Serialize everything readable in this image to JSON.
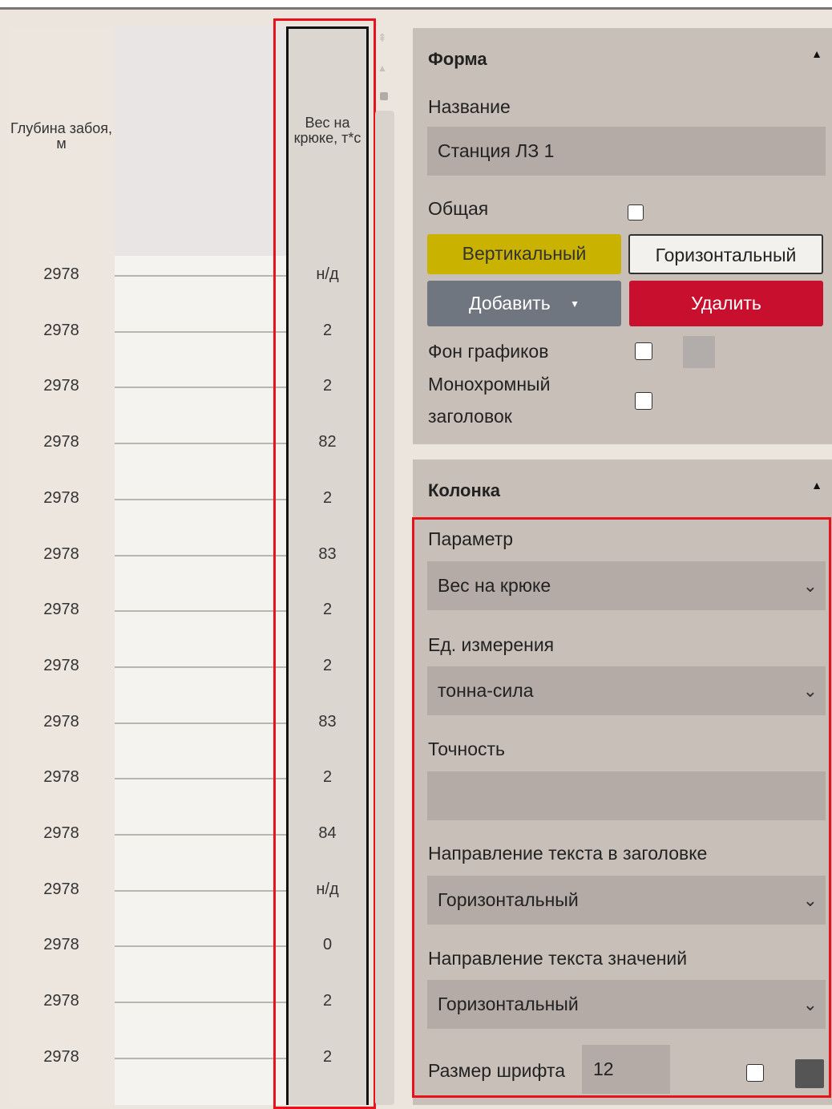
{
  "track": {
    "depth_header": "Глубина забоя, м",
    "value_header": "Вес на крюке, т*с",
    "rows": [
      {
        "depth": "2978",
        "value": "н/д"
      },
      {
        "depth": "2978",
        "value": "2"
      },
      {
        "depth": "2978",
        "value": "2"
      },
      {
        "depth": "2978",
        "value": "82"
      },
      {
        "depth": "2978",
        "value": "2"
      },
      {
        "depth": "2978",
        "value": "83"
      },
      {
        "depth": "2978",
        "value": "2"
      },
      {
        "depth": "2978",
        "value": "2"
      },
      {
        "depth": "2978",
        "value": "83"
      },
      {
        "depth": "2978",
        "value": "2"
      },
      {
        "depth": "2978",
        "value": "84"
      },
      {
        "depth": "2978",
        "value": "н/д"
      },
      {
        "depth": "2978",
        "value": "0"
      },
      {
        "depth": "2978",
        "value": "2"
      },
      {
        "depth": "2978",
        "value": "2"
      }
    ]
  },
  "form": {
    "title": "Форма",
    "name_label": "Название",
    "name_value": "Станция ЛЗ 1",
    "shared_label": "Общая",
    "vertical_button": "Вертикальный",
    "horizontal_button": "Горизонтальный",
    "add_button": "Добавить",
    "delete_button": "Удалить",
    "chart_bg_label": "Фон графиков",
    "mono_label_1": "Монохромный",
    "mono_label_2": "заголовок"
  },
  "column": {
    "title": "Колонка",
    "param_label": "Параметр",
    "param_value": "Вес на крюке",
    "unit_label": "Ед. измерения",
    "unit_value": "тонна-сила",
    "precision_label": "Точность",
    "precision_value": "",
    "header_dir_label": "Направление текста в заголовке",
    "header_dir_value": "Горизонтальный",
    "values_dir_label": "Направление текста значений",
    "values_dir_value": "Горизонтальный",
    "font_size_label": "Размер шрифта",
    "font_size_value": "12"
  },
  "colors": {
    "accent_yellow": "#c9b200",
    "danger_red": "#c8102e",
    "highlight_frame": "#e8131a",
    "chart_bg_swatch": "#b2adaa",
    "font_color_swatch": "#555555"
  }
}
